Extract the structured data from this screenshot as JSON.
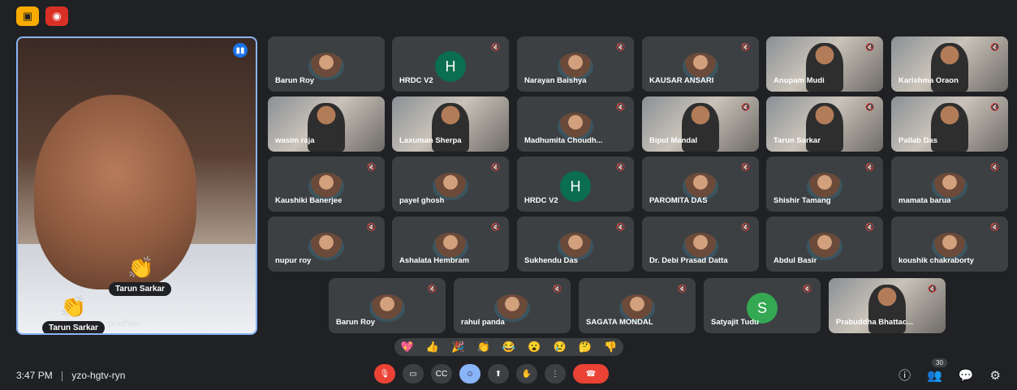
{
  "meeting": {
    "time": "3:47 PM",
    "code": "yzo-hgtv-ryn"
  },
  "speaker": {
    "name_pill_top": "Tarun Sarkar",
    "name_pill_bottom": "Tarun Sarkar",
    "background_label": "pradhan"
  },
  "tiles": [
    {
      "name": "Barun Roy",
      "type": "avatar",
      "muted": false
    },
    {
      "name": "HRDC V2",
      "type": "initial",
      "initial": "H",
      "muted": true
    },
    {
      "name": "Narayan Baishya",
      "type": "avatar",
      "muted": true
    },
    {
      "name": "KAUSAR ANSARI",
      "type": "avatar",
      "muted": true
    },
    {
      "name": "Anupam Mudi",
      "type": "video",
      "muted": true
    },
    {
      "name": "Karishma Oraon",
      "type": "video",
      "muted": true
    },
    {
      "name": "wasim raja",
      "type": "video",
      "muted": false
    },
    {
      "name": "Laxuman Sherpa",
      "type": "video",
      "muted": false
    },
    {
      "name": "Madhumita Choudh...",
      "type": "avatar",
      "muted": true
    },
    {
      "name": "Bipul Mandal",
      "type": "video",
      "muted": true
    },
    {
      "name": "Tarun Sarkar",
      "type": "video",
      "muted": true
    },
    {
      "name": "Pallab Das",
      "type": "video",
      "muted": true
    },
    {
      "name": "Kaushiki Banerjee",
      "type": "avatar",
      "muted": true
    },
    {
      "name": "payel ghosh",
      "type": "avatar",
      "muted": true
    },
    {
      "name": "HRDC V2",
      "type": "initial",
      "initial": "H",
      "muted": true
    },
    {
      "name": "PAROMITA DAS",
      "type": "avatar",
      "muted": true
    },
    {
      "name": "Shishir Tamang",
      "type": "avatar",
      "muted": true
    },
    {
      "name": "mamata barua",
      "type": "avatar",
      "muted": true
    },
    {
      "name": "nupur roy",
      "type": "avatar",
      "muted": true
    },
    {
      "name": "Ashalata Hembram",
      "type": "avatar",
      "muted": true
    },
    {
      "name": "Sukhendu Das",
      "type": "avatar",
      "muted": true
    },
    {
      "name": "Dr. Debi Prasad Datta",
      "type": "avatar",
      "muted": true
    },
    {
      "name": "Abdul Basir",
      "type": "avatar",
      "muted": true
    },
    {
      "name": "koushik chakraborty",
      "type": "avatar",
      "muted": true
    },
    {
      "name": "Barun Roy",
      "type": "avatar",
      "muted": true
    },
    {
      "name": "rahul panda",
      "type": "avatar",
      "muted": true
    },
    {
      "name": "SAGATA MONDAL",
      "type": "avatar",
      "muted": true
    },
    {
      "name": "Satyajit Tudu",
      "type": "initial",
      "initial": "S",
      "muted": true
    },
    {
      "name": "Prabuddha Bhattac...",
      "type": "video",
      "muted": true
    }
  ],
  "reactions": [
    "💖",
    "👍",
    "🎉",
    "👏",
    "😂",
    "😮",
    "😢",
    "🤔",
    "👎"
  ],
  "participants_count": "30",
  "controls": [
    "mic-off",
    "camera",
    "captions",
    "emoji",
    "present",
    "raise-hand",
    "more",
    "end-call"
  ],
  "icons": {
    "info": "info-icon",
    "people": "people-icon",
    "chat": "chat-icon",
    "activities": "activities-icon"
  }
}
